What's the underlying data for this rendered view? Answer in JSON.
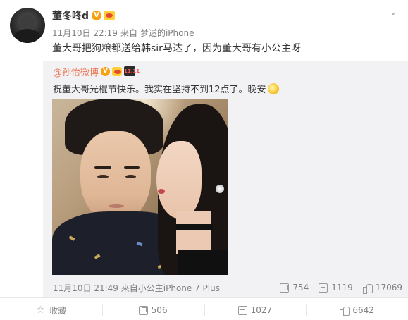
{
  "post": {
    "author": "董冬咚d",
    "verified_badge": "V",
    "date": "11月10日 22:19",
    "source_prefix": "来自",
    "source": "梦逑的iPhone",
    "text": "董大哥把狗粮都送给韩sir马达了，因为董大哥有小公主呀"
  },
  "repost": {
    "author": "@孙怡微博",
    "verified_badge": "V",
    "badge_1111": "11.11",
    "text": "祝董大哥光棍节快乐。我实在坚持不到12点了。晚安",
    "date": "11月10日 21:49",
    "source_prefix": "来自",
    "source": "小公主iPhone 7 Plus",
    "forwards": "754",
    "comments": "1119",
    "likes": "17069"
  },
  "actions": {
    "favorite": "收藏",
    "forwards": "506",
    "comments": "1027",
    "likes": "6642"
  },
  "icons": {
    "menu": "chevron-down-icon",
    "forward": "forward-icon",
    "comment": "comment-icon",
    "like": "thumbs-up-icon",
    "favorite": "star-icon"
  },
  "colors": {
    "link": "#eb7350",
    "meta": "#808080",
    "repost_bg": "#f2f2f5",
    "verified": "#f7a20d"
  }
}
